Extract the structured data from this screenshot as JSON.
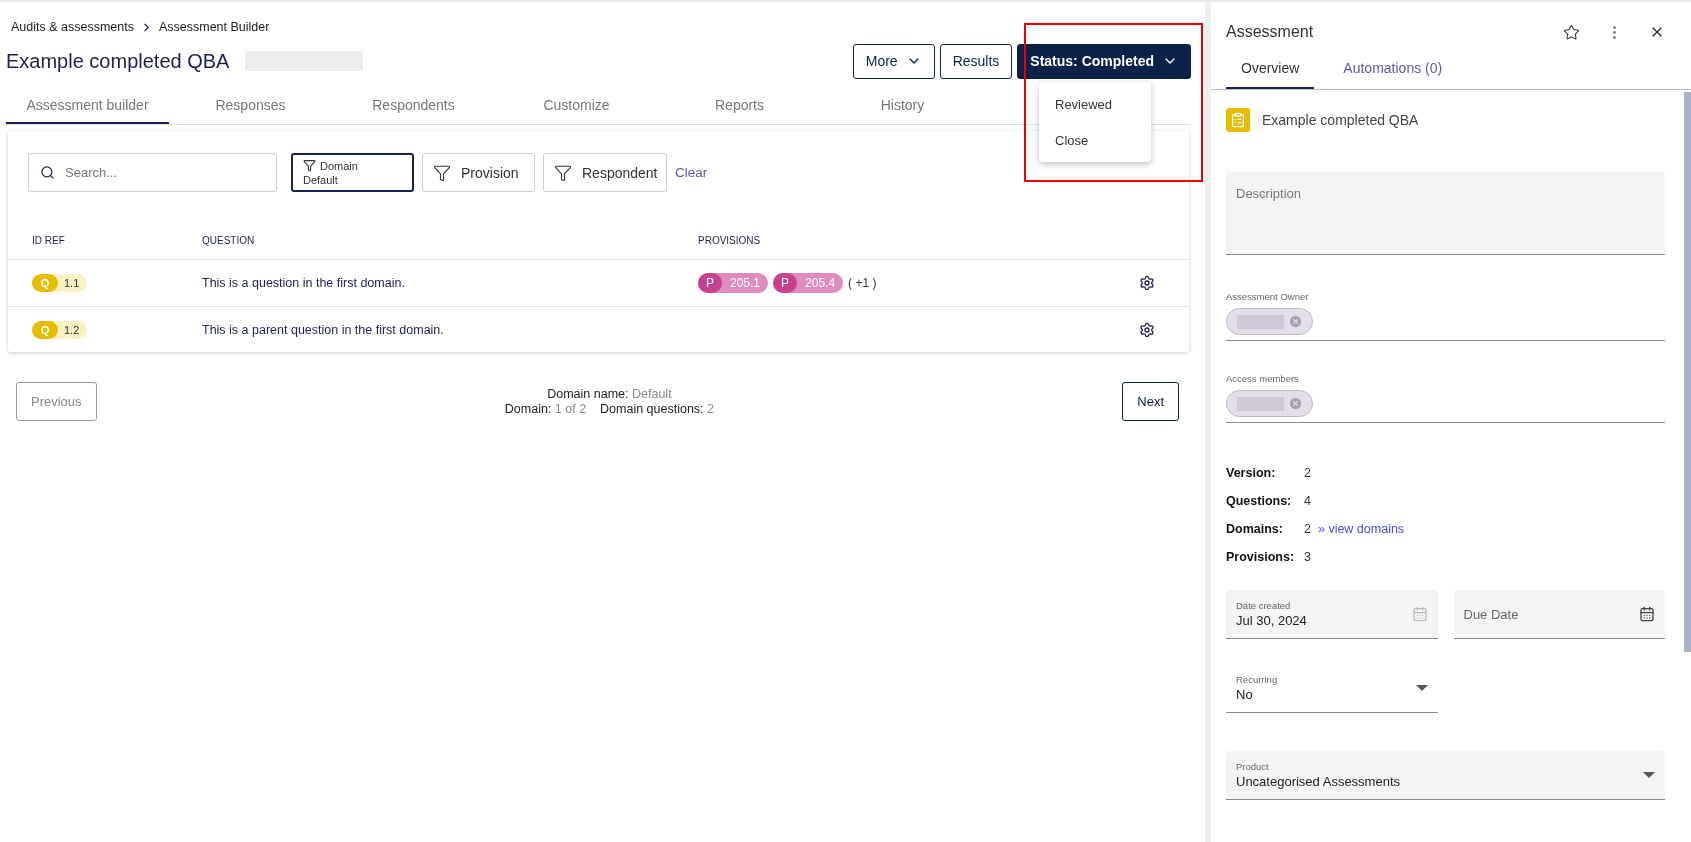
{
  "breadcrumb": [
    "Audits & assessments",
    "Assessment Builder"
  ],
  "title": "Example completed QBA",
  "header_buttons": [
    {
      "label": "More",
      "kind": "menu"
    },
    {
      "label": "Results",
      "kind": "outline"
    },
    {
      "label": "Status: Completed",
      "kind": "primary"
    }
  ],
  "status_menu": {
    "items": [
      "Reviewed",
      "Close"
    ]
  },
  "tabs": [
    {
      "label": "Assessment builder",
      "selected": true
    },
    {
      "label": "Responses",
      "selected": false
    },
    {
      "label": "Respondents",
      "selected": false
    },
    {
      "label": "Customize",
      "selected": false
    },
    {
      "label": "Reports",
      "selected": false
    },
    {
      "label": "History",
      "selected": false
    }
  ],
  "search": {
    "placeholder": "Search..."
  },
  "filters": [
    {
      "label": "Domain",
      "value": "Default",
      "selected": true
    },
    {
      "label": "Provision",
      "selected": false
    },
    {
      "label": "Respondent",
      "selected": false
    }
  ],
  "clear": "Clear",
  "table": {
    "columns": [
      "ID REF",
      "QUESTION",
      "PROVISIONS"
    ],
    "rows": [
      {
        "badge": "Q",
        "id": "1.1",
        "question": "This is a question in the first domain.",
        "provisions": [
          {
            "prefix": "P",
            "code": "205.1"
          },
          {
            "prefix": "P",
            "code": "205.4"
          }
        ],
        "more": "( +1 )"
      },
      {
        "badge": "Q",
        "id": "1.2",
        "question": "This is a parent question in the first domain.",
        "provisions": []
      }
    ]
  },
  "pagination": {
    "previous": {
      "label": "Previous",
      "disabled": true
    },
    "next": {
      "label": "Next",
      "disabled": false
    },
    "domain_name_label": "Domain name:",
    "domain_name": "Default",
    "domain_label": "Domain:",
    "domain": "1 of 2",
    "questions_label": "Domain questions:",
    "questions": "2"
  },
  "panel": {
    "title": "Assessment",
    "tabs": [
      {
        "label": "Overview",
        "selected": true
      },
      {
        "label": "Automations (0)",
        "selected": false
      }
    ],
    "item_name": "Example completed QBA",
    "description": {
      "placeholder": "Description"
    },
    "owner": {
      "label": "Assessment Owner"
    },
    "access": {
      "label": "Access members"
    },
    "stats": [
      {
        "label": "Version:",
        "value": "2"
      },
      {
        "label": "Questions:",
        "value": "4"
      },
      {
        "label": "Domains:",
        "value": "2",
        "link": "» view domains"
      },
      {
        "label": "Provisions:",
        "value": "3"
      }
    ],
    "date_created": {
      "label": "Date created",
      "value": "Jul 30, 2024",
      "disabled": true
    },
    "due_date": {
      "placeholder": "Due Date",
      "disabled": false
    },
    "recurring": {
      "label": "Recurring",
      "value": "No"
    },
    "product": {
      "label": "Product",
      "value": "Uncategorised Assessments"
    }
  }
}
